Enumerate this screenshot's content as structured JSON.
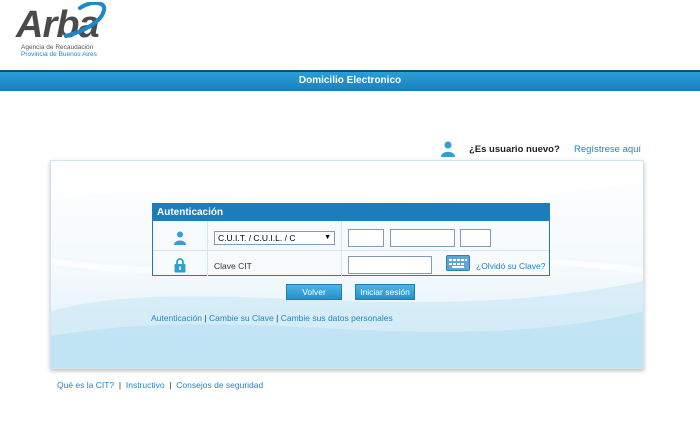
{
  "logo": {
    "name": "Arba",
    "subtitle_line1": "Agencia de Recaudación",
    "subtitle_line2": "Provincia de Buenos Aires"
  },
  "header": {
    "title": "Domicilio Electronico"
  },
  "new_user": {
    "question": "¿Es usuario nuevo?",
    "register_link": "Regístrese aquí"
  },
  "auth": {
    "title": "Autenticación",
    "id_type_selected": "C.U.I.T. / C.U.I.L. / C",
    "id_part1": "",
    "id_part2": "",
    "id_part3": "",
    "password_label": "Clave CIT",
    "password_value": "",
    "forgot_link": "¿Olvidó su Clave?",
    "back_button": "Volver",
    "login_button": "Iniciar sesión"
  },
  "links": {
    "auth": "Autenticación",
    "change_password": "Cambie su Clave",
    "change_data": "Cambie sus datos personales",
    "separator": "|"
  },
  "footer": {
    "what_is_cit": "Qué es la CIT?",
    "instructions": "Instructivo",
    "security": "Consejos de seguridad",
    "separator": "|"
  },
  "icons": {
    "user": "user-icon",
    "lock": "lock-icon",
    "keyboard": "keyboard-icon",
    "new_user": "person-icon"
  },
  "colors": {
    "accent": "#1c7dbd",
    "link": "#1f86c9",
    "header_bar": "#2a9ed6"
  }
}
